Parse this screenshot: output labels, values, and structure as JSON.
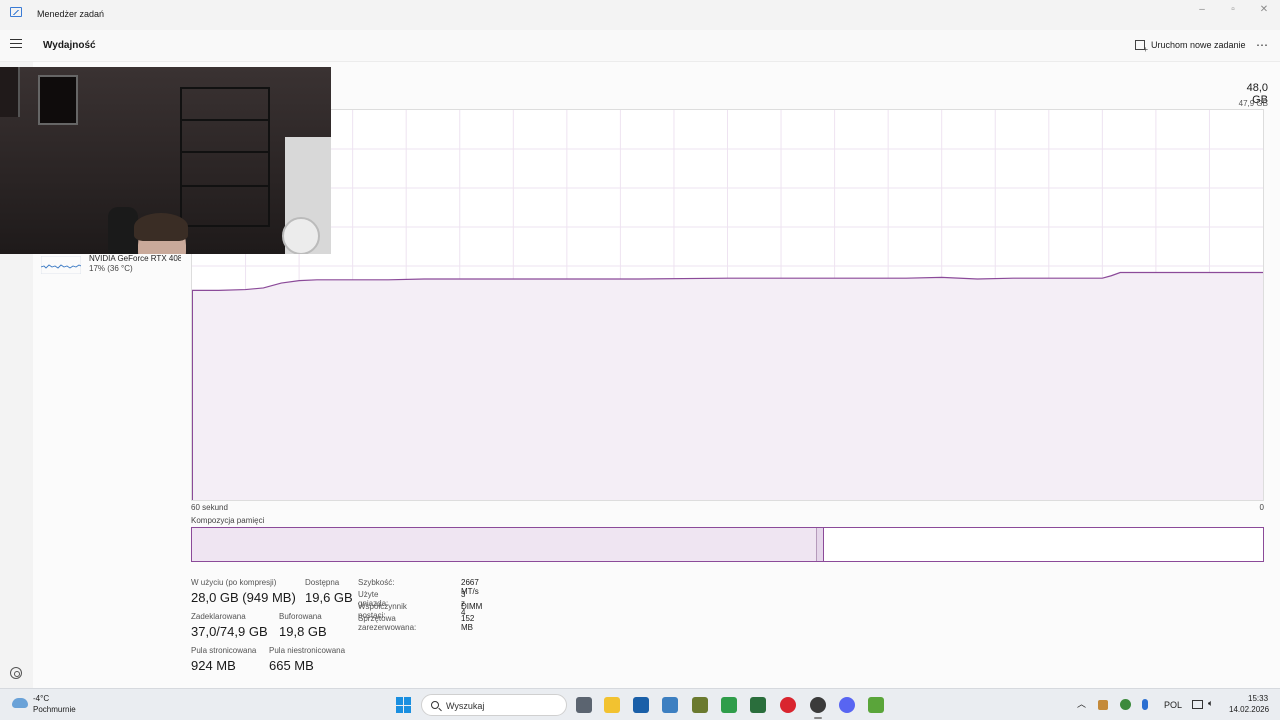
{
  "window": {
    "title": "Menedżer zadań",
    "minimize_icon": "minimize-icon",
    "maximize_icon": "maximize-icon",
    "close_icon": "close-icon"
  },
  "header": {
    "title": "Wydajność",
    "new_task_label": "Uruchom nowe zadanie",
    "more_label": "⋯"
  },
  "sidebar": {
    "gpu": {
      "name": "NVIDIA GeForce RTX 408",
      "utilization": "17%  (36 °C)"
    }
  },
  "memory": {
    "max_label": "48,0 GB",
    "current_label": "47,9 GB",
    "axis_left": "60 sekund",
    "axis_right": "0",
    "composition_label": "Kompozycja pamięci",
    "composition": {
      "in_use_fraction": 0.584,
      "modified_fraction": 0.006
    },
    "stats": {
      "in_use_label": "W użyciu (po kompresji)",
      "in_use_value": "28,0 GB (949 MB)",
      "available_label": "Dostępna",
      "available_value": "19,6 GB",
      "committed_label": "Zadeklarowana",
      "committed_value": "37,0/74,9 GB",
      "cached_label": "Buforowana",
      "cached_value": "19,8 GB",
      "paged_label": "Pula stronicowana",
      "paged_value": "924 MB",
      "nonpaged_label": "Pula niestronicowana",
      "nonpaged_value": "665 MB"
    },
    "info": [
      {
        "key": "Szybkość:",
        "value": "2667 MT/s"
      },
      {
        "key": "Użyte gniazda:",
        "value": "3 z 4"
      },
      {
        "key": "Współczynnik postaci:",
        "value": "DIMM"
      },
      {
        "key": "Sprzętowa zarezerwowana:",
        "value": "152 MB"
      }
    ]
  },
  "chart_data": {
    "type": "area",
    "title": "",
    "xlabel": "",
    "ylabel": "",
    "xlim": [
      60,
      0
    ],
    "ylim": [
      0,
      48
    ],
    "x": [
      60,
      58.5,
      57,
      56,
      55,
      54,
      53,
      51,
      49,
      47,
      45,
      43,
      40,
      37,
      35,
      30,
      25,
      20,
      18,
      16,
      14,
      12,
      10,
      9,
      8.5,
      8,
      6,
      4,
      2,
      0
    ],
    "series": [
      {
        "values": [
          25.8,
          25.8,
          25.9,
          26.1,
          26.7,
          27.0,
          27.1,
          27.1,
          27.1,
          27.2,
          27.2,
          27.2,
          27.2,
          27.2,
          27.2,
          27.3,
          27.3,
          27.3,
          27.4,
          27.2,
          27.3,
          27.3,
          27.3,
          27.3,
          27.6,
          28.0,
          28.0,
          28.0,
          28.0,
          28.0
        ]
      }
    ],
    "grid": true,
    "line_color": "#8b4a99",
    "fill_color": "#f4eef6"
  },
  "taskbar": {
    "weather_temp": "-4°C",
    "weather_desc": "Pochmurnie",
    "search_placeholder": "Wyszukaj",
    "language": "POL",
    "time": "15:33",
    "date": "14.02.2026"
  }
}
